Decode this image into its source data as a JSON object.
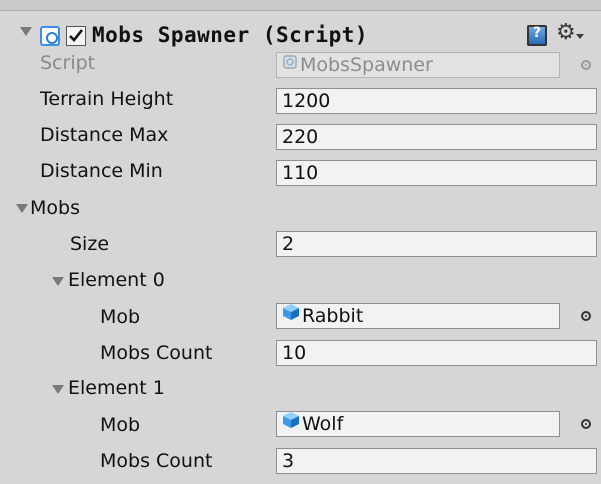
{
  "component": {
    "title": "Mobs Spawner (Script)",
    "enabled": true,
    "help_icon": "book-help-icon",
    "settings_icon": "gear-icon"
  },
  "script": {
    "label": "Script",
    "value": "MobsSpawner"
  },
  "fields": {
    "terrain_height": {
      "label": "Terrain Height",
      "value": "1200"
    },
    "distance_max": {
      "label": "Distance Max",
      "value": "220"
    },
    "distance_min": {
      "label": "Distance Min",
      "value": "110"
    }
  },
  "mobs": {
    "label": "Mobs",
    "size_label": "Size",
    "size_value": "2",
    "elements": [
      {
        "label": "Element 0",
        "mob_label": "Mob",
        "mob_value": "Rabbit",
        "count_label": "Mobs Count",
        "count_value": "10"
      },
      {
        "label": "Element 1",
        "mob_label": "Mob",
        "mob_value": "Wolf",
        "count_label": "Mobs Count",
        "count_value": "3"
      }
    ]
  },
  "colors": {
    "panel_bg": "#d6d6d6",
    "field_bg": "#f2f2f2",
    "accent": "#3a8ee8"
  }
}
